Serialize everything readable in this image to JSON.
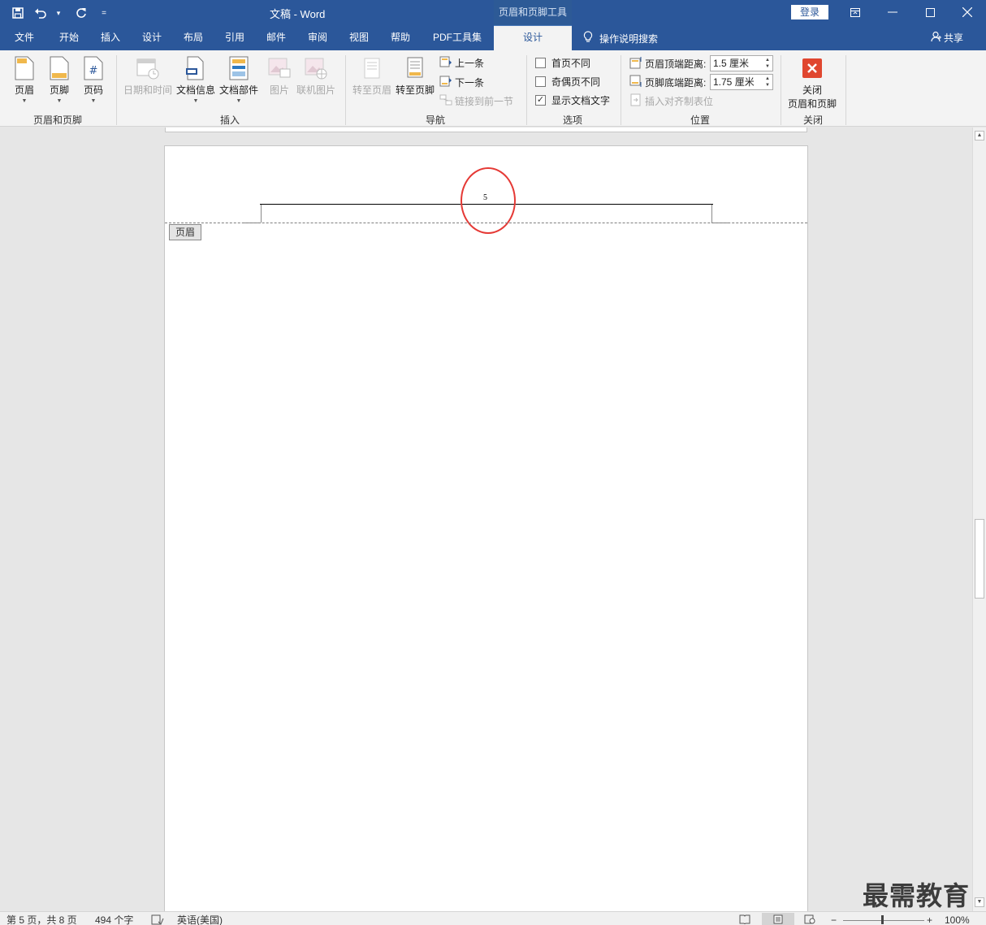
{
  "app": {
    "doc_title": "文稿  -  Word",
    "context_tab_title": "页眉和页脚工具",
    "login_label": "登录",
    "quick_access": [
      "save-icon",
      "undo-icon",
      "redo-icon",
      "customize-qat-icon"
    ]
  },
  "tabs": {
    "items": [
      {
        "label": "文件"
      },
      {
        "label": "开始"
      },
      {
        "label": "插入"
      },
      {
        "label": "设计"
      },
      {
        "label": "布局"
      },
      {
        "label": "引用"
      },
      {
        "label": "邮件"
      },
      {
        "label": "审阅"
      },
      {
        "label": "视图"
      },
      {
        "label": "帮助"
      },
      {
        "label": "PDF工具集"
      }
    ],
    "active": "设计",
    "tell_me": "操作说明搜索",
    "share": "共享"
  },
  "ribbon": {
    "group_header_footer": {
      "label": "页眉和页脚",
      "header": "页眉",
      "footer": "页脚",
      "page_number": "页码"
    },
    "group_insert": {
      "label": "插入",
      "date_time": "日期和时间",
      "doc_info": "文档信息",
      "quick_parts": "文档部件",
      "pictures": "图片",
      "online_pictures": "联机图片"
    },
    "group_nav": {
      "label": "导航",
      "goto_header": "转至页眉",
      "goto_footer": "转至页脚",
      "previous": "上一条",
      "next": "下一条",
      "link_previous": "链接到前一节"
    },
    "group_options": {
      "label": "选项",
      "different_first": "首页不同",
      "different_first_checked": false,
      "different_odd_even": "奇偶页不同",
      "different_odd_even_checked": false,
      "show_doc_text": "显示文档文字",
      "show_doc_text_checked": true
    },
    "group_position": {
      "label": "位置",
      "header_from_top_label": "页眉顶端距离:",
      "header_from_top_value": "1.5 厘米",
      "footer_from_bottom_label": "页脚底端距离:",
      "footer_from_bottom_value": "1.75 厘米",
      "insert_align_tab": "插入对齐制表位"
    },
    "group_close": {
      "label": "关闭",
      "close_line1": "关闭",
      "close_line2": "页眉和页脚"
    }
  },
  "document": {
    "header_page_number": "5",
    "header_tag": "页眉"
  },
  "statusbar": {
    "page_info": "第 5 页，共 8 页",
    "word_count": "494 个字",
    "language": "英语(美国)",
    "zoom": "100%"
  },
  "watermark": "最需教育",
  "colors": {
    "title_bar": "#2b579a",
    "annotation_circle": "#e53935",
    "close_button": "#e0462f"
  }
}
